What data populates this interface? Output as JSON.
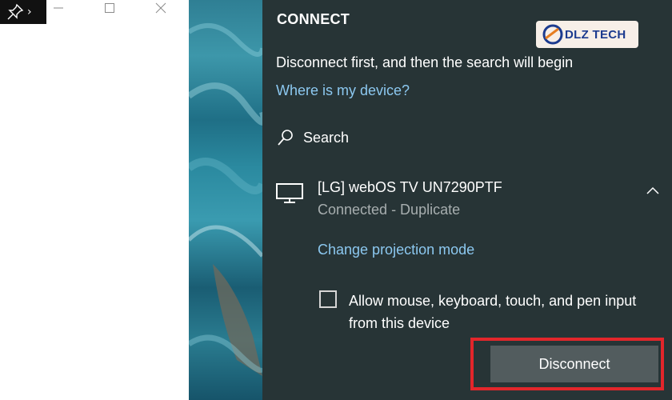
{
  "panel": {
    "title": "CONNECT",
    "hint": "Disconnect first, and then the search will begin",
    "where_link": "Where is my device?",
    "search_label": "Search"
  },
  "device": {
    "name": "[LG] webOS TV UN7290PTF",
    "status": "Connected - Duplicate",
    "change_mode_link": "Change projection mode",
    "allow_input_label": "Allow mouse, keyboard, touch, and pen input from this device",
    "allow_input_checked": false,
    "disconnect_label": "Disconnect"
  },
  "watermark": {
    "brand": "DLZ TECH"
  },
  "colors": {
    "panel_bg": "#273436",
    "link": "#8cc8f0",
    "highlight": "#e2262b",
    "button_bg": "#525c5e"
  },
  "icons": [
    "pin-icon",
    "minimize-icon",
    "maximize-icon",
    "close-icon",
    "search-icon",
    "monitor-icon",
    "chevron-up-icon"
  ]
}
